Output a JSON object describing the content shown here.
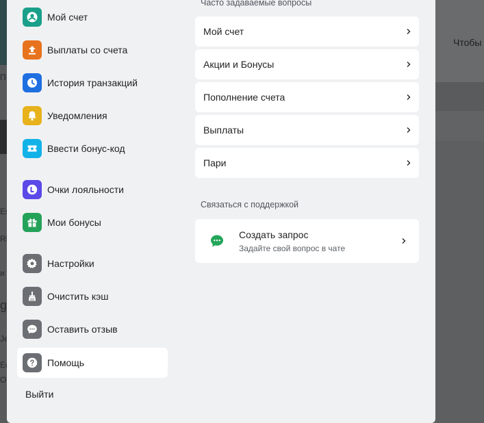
{
  "background": {
    "right_text": "Чтобы",
    "left_fragments": [
      "П",
      "Es",
      "RE",
      "и",
      "g",
      "Je",
      "Ed",
      "OH"
    ]
  },
  "menu": {
    "items": [
      {
        "label": "Мой счет",
        "icon": "user-icon",
        "color": "#1aa08a"
      },
      {
        "label": "Выплаты со счета",
        "icon": "upload-icon",
        "color": "#e8731e"
      },
      {
        "label": "История транзакций",
        "icon": "clock-icon",
        "color": "#1e6fe0"
      },
      {
        "label": "Уведомления",
        "icon": "bell-icon",
        "color": "#e7b21b"
      },
      {
        "label": "Ввести бонус-код",
        "icon": "ticket-icon",
        "color": "#12b2e8"
      },
      {
        "label": "Очки лояльности",
        "icon": "loyalty-icon",
        "color": "#5b49e8"
      },
      {
        "label": "Мои бонусы",
        "icon": "gift-icon",
        "color": "#25a25a"
      },
      {
        "label": "Настройки",
        "icon": "gear-icon",
        "color": "#6b6f74"
      },
      {
        "label": "Очистить кэш",
        "icon": "broom-icon",
        "color": "#6b6f74"
      },
      {
        "label": "Оставить отзыв",
        "icon": "chat-icon",
        "color": "#6b6f74"
      },
      {
        "label": "Помощь",
        "icon": "help-icon",
        "color": "#6b6f74"
      }
    ],
    "active": "Помощь",
    "logout_label": "Выйти"
  },
  "faq": {
    "title": "Часто задаваемые вопросы",
    "items": [
      "Мой счет",
      "Акции и Бонусы",
      "Пополнение счета",
      "Выплаты",
      "Пари"
    ]
  },
  "support": {
    "title": "Связаться с поддержкой",
    "card_title": "Создать запрос",
    "card_subtitle": "Задайте свой вопрос в чате",
    "icon": "chat-bubble-icon",
    "icon_color": "#23a65a"
  }
}
